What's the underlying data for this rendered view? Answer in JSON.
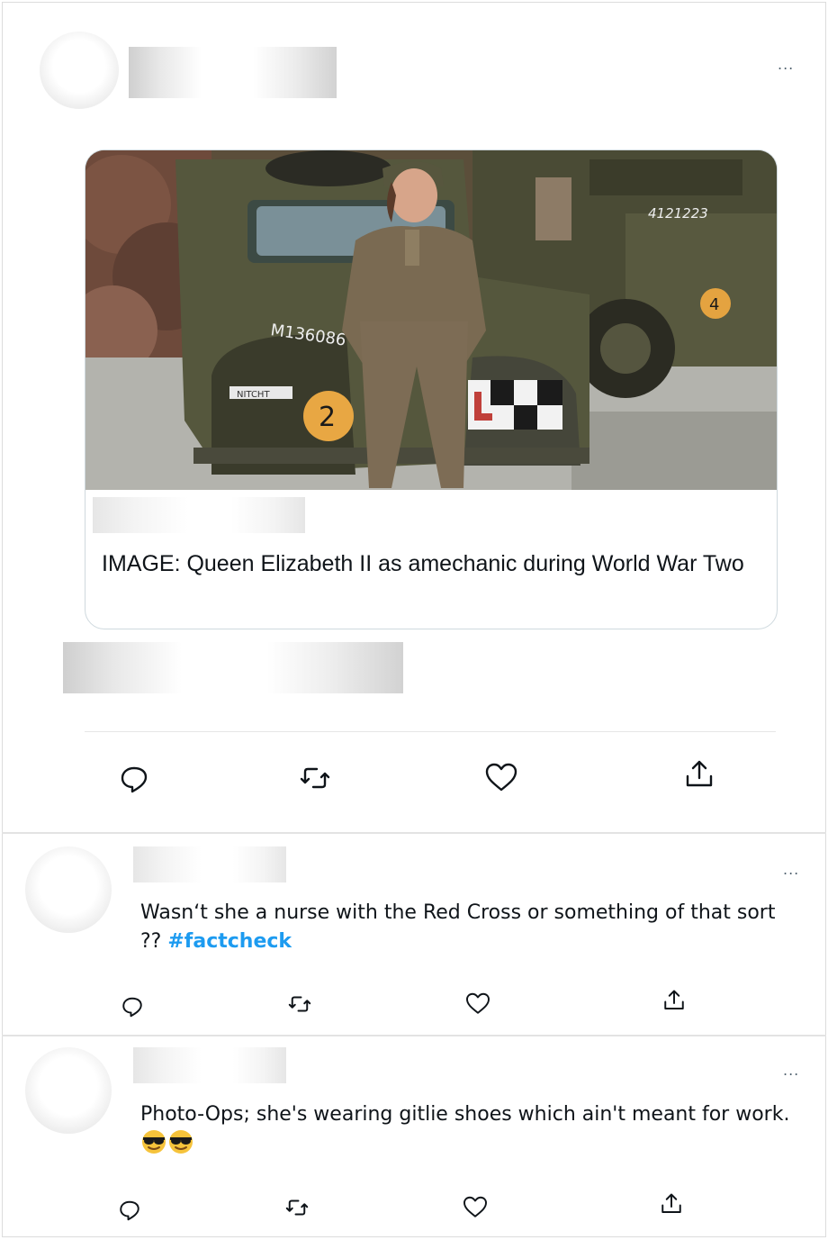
{
  "main_tweet": {
    "more_label": "...",
    "card": {
      "vehicle_plate": "M136086",
      "rear_vehicle_plate": "4121223",
      "tactical_number_front": "2",
      "tactical_number_rear": "4",
      "front_plate_small": "NITCHT",
      "description": "IMAGE: Queen Elizabeth II as amechanic during World War Two"
    },
    "actions": [
      {
        "name": "reply-icon"
      },
      {
        "name": "retweet-icon"
      },
      {
        "name": "like-icon"
      },
      {
        "name": "share-icon"
      }
    ]
  },
  "replies": [
    {
      "more_label": "...",
      "text_before": "Wasn‘t she a nurse with the Red Cross or something of that sort ?? ",
      "hashtag": "#factcheck",
      "text_after": ""
    },
    {
      "more_label": "...",
      "text_before": "Photo-Ops; she's wearing gitlie shoes which ain't meant for work. ",
      "hashtag": "",
      "emoji": [
        "sunglasses-emoji",
        "sunglasses-emoji"
      ]
    }
  ],
  "colors": {
    "text": "#0f1419",
    "secondary": "#536471",
    "accent": "#1d9bf0",
    "border": "#cfd9de"
  }
}
